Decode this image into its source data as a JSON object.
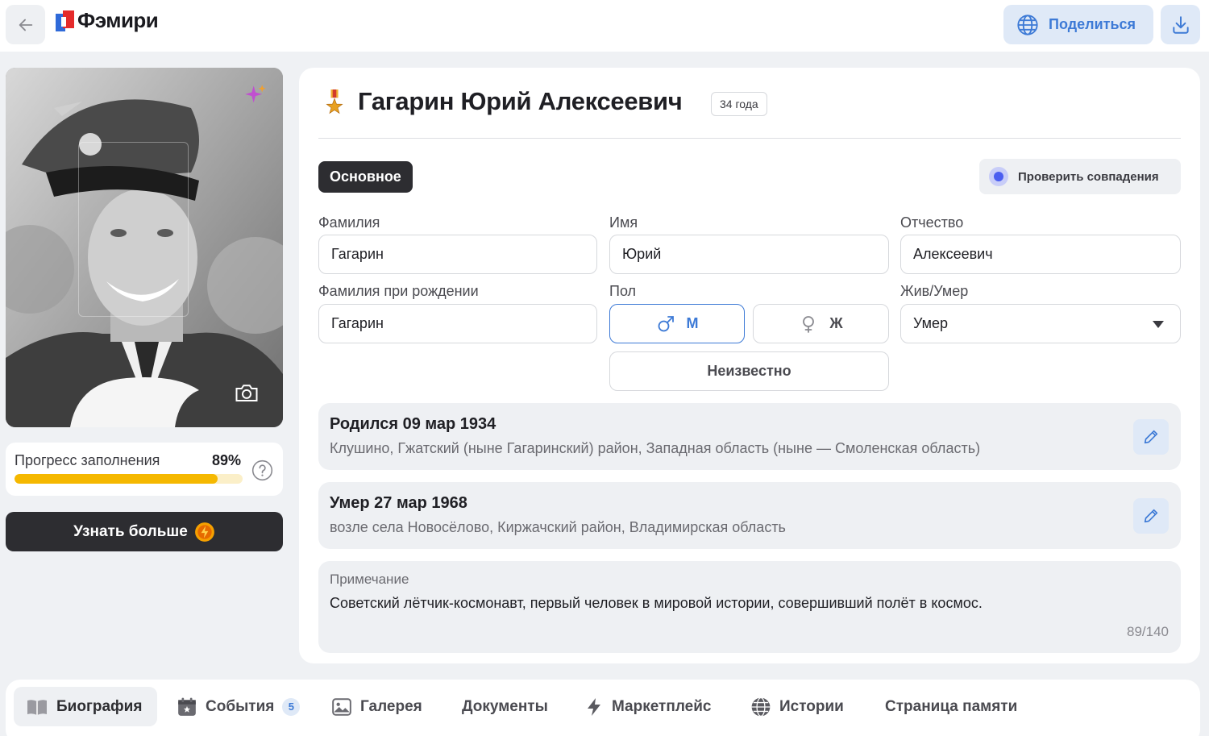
{
  "topbar": {
    "logo_text": "Фэмири",
    "share_label": "Поделиться",
    "icons": [
      "arrow-left-icon",
      "globe-icon",
      "download-icon"
    ]
  },
  "profile": {
    "progress_label": "Прогресс заполнения",
    "progress_value": "89%",
    "progress_fraction": 0.89,
    "learn_more_label": "Узнать больше"
  },
  "person": {
    "name": "Гагарин Юрий Алексеевич",
    "age_badge": "34 года"
  },
  "tabs": {
    "active": "Основное"
  },
  "check_matches_label": "Проверить совпадения",
  "form": {
    "surname_label": "Фамилия",
    "surname_value": "Гагарин",
    "name_label": "Имя",
    "name_value": "Юрий",
    "patronymic_label": "Отчество",
    "patronymic_value": "Алексеевич",
    "birth_surname_label": "Фамилия при рождении",
    "birth_surname_value": "Гагарин",
    "gender_label": "Пол",
    "gender_male": "М",
    "gender_female": "Ж",
    "gender_unknown": "Неизвестно",
    "alive_label": "Жив/Умер",
    "alive_value": "Умер"
  },
  "events": [
    {
      "title": "Родился 09 мар 1934",
      "place": "Клушино, Гжатский (ныне Гагаринский) район, Западная область (ныне — Смоленская область)"
    },
    {
      "title": "Умер 27 мар 1968",
      "place": "возле села Новосёлово, Киржачский район, Владимирская область"
    }
  ],
  "note": {
    "label": "Примечание",
    "text": "Советский лётчик-космонавт, первый человек в мировой истории, совершивший полёт в космос.",
    "counter": "89/140"
  },
  "bottom_nav": [
    {
      "label": "Биография",
      "icon": "book-icon"
    },
    {
      "label": "События",
      "icon": "calendar-icon",
      "count": "5"
    },
    {
      "label": "Галерея",
      "icon": "gallery-icon"
    },
    {
      "label": "Документы"
    },
    {
      "label": "Маркетплейс",
      "icon": "lightning-icon"
    },
    {
      "label": "Истории",
      "icon": "globe-icon"
    },
    {
      "label": "Страница памяти"
    }
  ],
  "colors": {
    "accent": "#3d7ad6",
    "progress": "#f5b800",
    "dark_button": "#2d2d31"
  }
}
